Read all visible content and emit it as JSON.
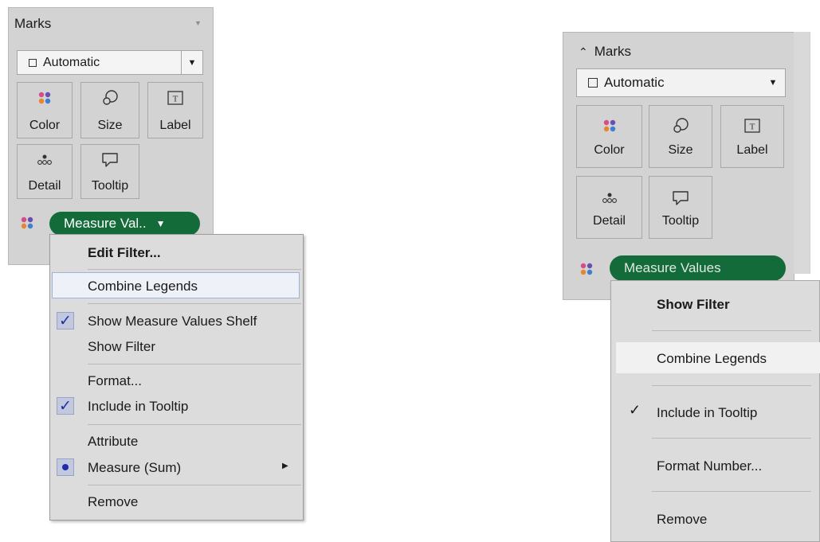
{
  "left_panel": {
    "title": "Marks",
    "mark_type": "Automatic",
    "buttons": {
      "color": "Color",
      "size": "Size",
      "label": "Label",
      "detail": "Detail",
      "tooltip": "Tooltip"
    },
    "pill_label": "Measure Val..",
    "menu": {
      "edit_filter": "Edit Filter...",
      "combine_legends": "Combine Legends",
      "show_measure_values_shelf": "Show Measure Values Shelf",
      "show_filter": "Show Filter",
      "format": "Format...",
      "include_in_tooltip": "Include in Tooltip",
      "attribute": "Attribute",
      "measure_sum": "Measure (Sum)",
      "remove": "Remove"
    }
  },
  "right_panel": {
    "title": "Marks",
    "mark_type": "Automatic",
    "buttons": {
      "color": "Color",
      "size": "Size",
      "label": "Label",
      "detail": "Detail",
      "tooltip": "Tooltip"
    },
    "pill_label": "Measure Values",
    "menu": {
      "show_filter": "Show Filter",
      "combine_legends": "Combine Legends",
      "include_in_tooltip": "Include in Tooltip",
      "format_number": "Format Number...",
      "remove": "Remove"
    }
  },
  "colors": {
    "pill_green": "#146b3a",
    "panel_gray": "#d3d3d3",
    "check_blue": "#1f2ea8"
  },
  "icons": [
    "color-dots-icon",
    "size-icon",
    "label-icon",
    "detail-icon",
    "tooltip-icon",
    "dropdown-arrow-icon",
    "checkmark-icon",
    "radio-icon",
    "submenu-arrow-icon",
    "collapse-caret-icon"
  ]
}
